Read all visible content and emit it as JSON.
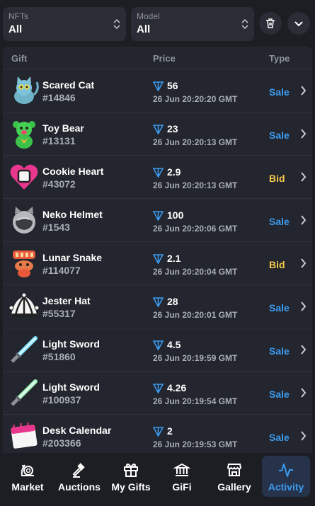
{
  "filters": {
    "nfts": {
      "label": "NFTs",
      "value": "All"
    },
    "model": {
      "label": "Model",
      "value": "All"
    }
  },
  "table": {
    "headers": {
      "gift": "Gift",
      "price": "Price",
      "type": "Type"
    },
    "rows": [
      {
        "name": "Scared Cat",
        "number": "#14846",
        "price": "56",
        "date": "26 Jun 20:20:20 GMT",
        "type": "Sale"
      },
      {
        "name": "Toy Bear",
        "number": "#13131",
        "price": "23",
        "date": "26 Jun 20:20:13 GMT",
        "type": "Sale"
      },
      {
        "name": "Cookie Heart",
        "number": "#43072",
        "price": "2.9",
        "date": "26 Jun 20:20:13 GMT",
        "type": "Bid"
      },
      {
        "name": "Neko Helmet",
        "number": "#1543",
        "price": "100",
        "date": "26 Jun 20:20:06 GMT",
        "type": "Sale"
      },
      {
        "name": "Lunar Snake",
        "number": "#114077",
        "price": "2.1",
        "date": "26 Jun 20:20:04 GMT",
        "type": "Bid"
      },
      {
        "name": "Jester Hat",
        "number": "#55317",
        "price": "28",
        "date": "26 Jun 20:20:01 GMT",
        "type": "Sale"
      },
      {
        "name": "Light Sword",
        "number": "#51860",
        "price": "4.5",
        "date": "26 Jun 20:19:59 GMT",
        "type": "Sale"
      },
      {
        "name": "Light Sword",
        "number": "#100937",
        "price": "4.26",
        "date": "26 Jun 20:19:54 GMT",
        "type": "Sale"
      },
      {
        "name": "Desk Calendar",
        "number": "#203366",
        "price": "2",
        "date": "26 Jun 20:19:53 GMT",
        "type": "Sale"
      }
    ]
  },
  "nav": {
    "items": [
      {
        "label": "Market",
        "icon": "snail-icon"
      },
      {
        "label": "Auctions",
        "icon": "gavel-icon"
      },
      {
        "label": "My Gifts",
        "icon": "gift-icon"
      },
      {
        "label": "GiFi",
        "icon": "bank-icon"
      },
      {
        "label": "Gallery",
        "icon": "store-icon"
      },
      {
        "label": "Activity",
        "icon": "activity-icon"
      }
    ],
    "active": "Activity"
  },
  "colors": {
    "accent": "#3b9bf0",
    "bid": "#f3c94a",
    "background": "#1c1e24",
    "panel": "#23262e"
  }
}
